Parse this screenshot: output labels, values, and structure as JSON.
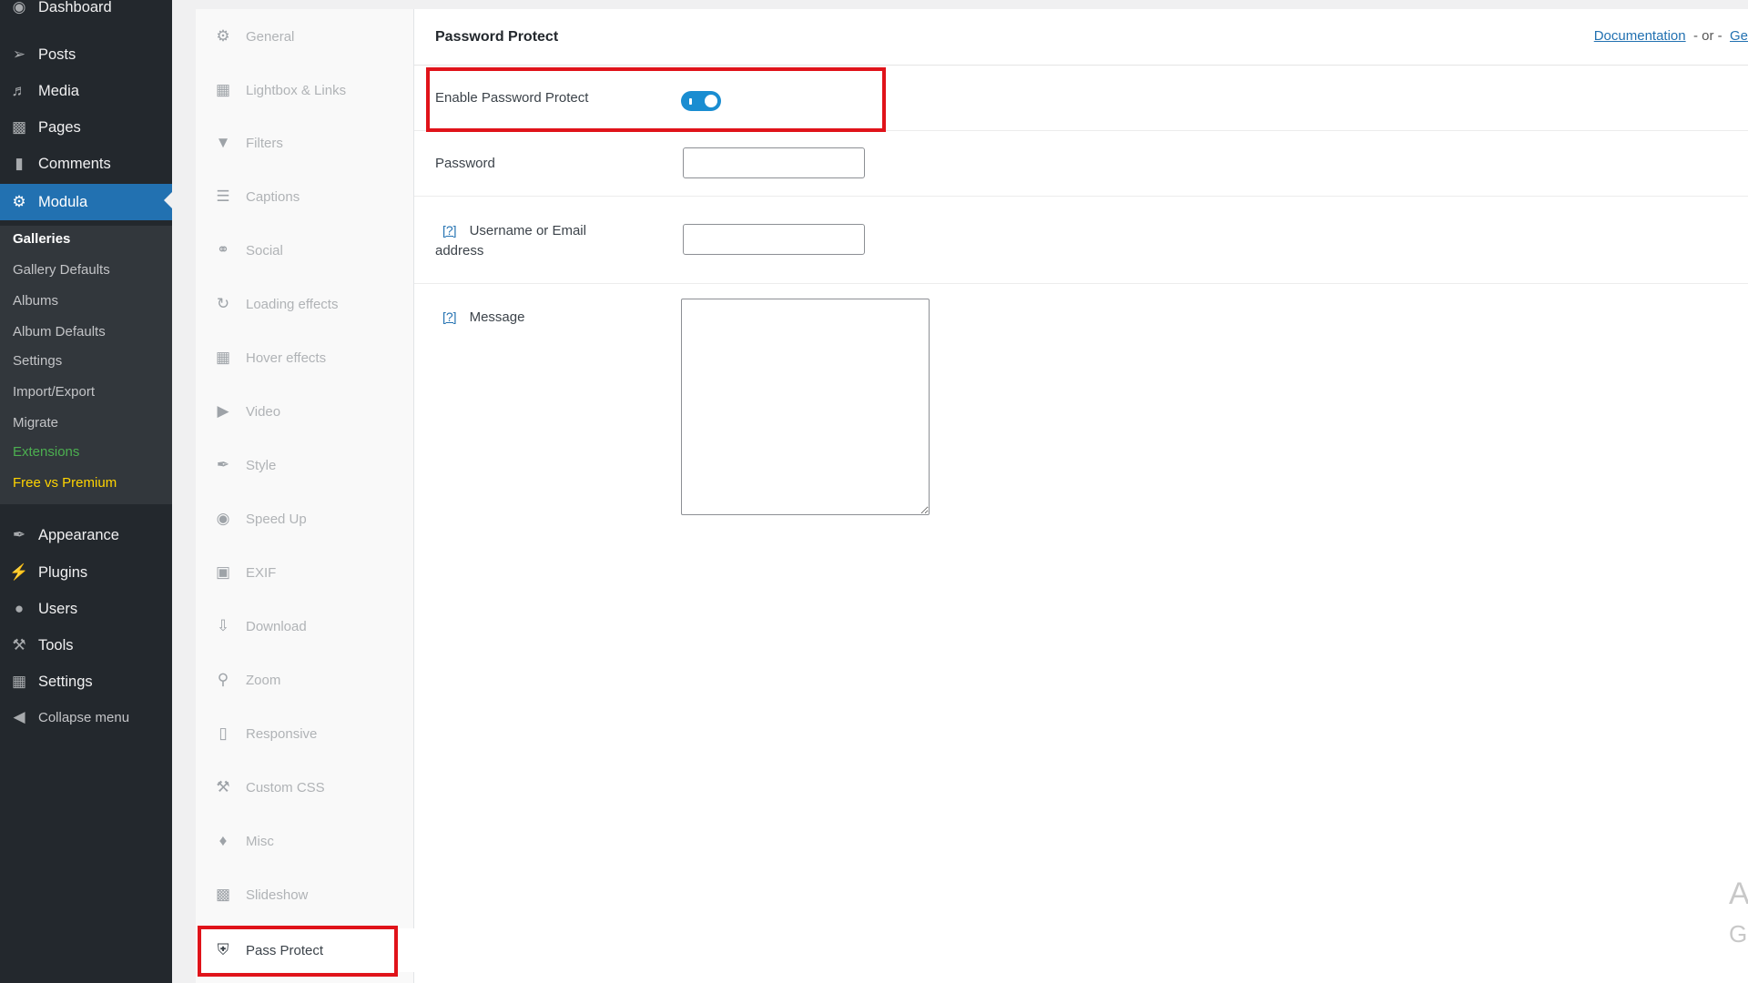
{
  "admin_menu": {
    "dashboard": "Dashboard",
    "posts": "Posts",
    "media": "Media",
    "pages": "Pages",
    "comments": "Comments",
    "modula": "Modula",
    "appearance": "Appearance",
    "plugins": "Plugins",
    "users": "Users",
    "tools": "Tools",
    "settings": "Settings",
    "collapse": "Collapse menu",
    "submenu": {
      "galleries": "Galleries",
      "gallery_defaults": "Gallery Defaults",
      "albums": "Albums",
      "album_defaults": "Album Defaults",
      "settings": "Settings",
      "import_export": "Import/Export",
      "migrate": "Migrate",
      "extensions": "Extensions",
      "free_vs_premium": "Free vs Premium"
    }
  },
  "tabs": {
    "general": "General",
    "lightbox": "Lightbox & Links",
    "filters": "Filters",
    "captions": "Captions",
    "social": "Social",
    "loading_effects": "Loading effects",
    "hover_effects": "Hover effects",
    "video": "Video",
    "style": "Style",
    "speed_up": "Speed Up",
    "exif": "EXIF",
    "download": "Download",
    "zoom": "Zoom",
    "responsive": "Responsive",
    "custom_css": "Custom CSS",
    "misc": "Misc",
    "slideshow": "Slideshow",
    "pass_protect": "Pass Protect"
  },
  "panel": {
    "title": "Password Protect",
    "documentation_link": "Documentation",
    "separator": "- or -",
    "second_link_partial": "Ge",
    "fields": {
      "enable_label": "Enable Password Protect",
      "enable_value": true,
      "password_label": "Password",
      "password_value": "",
      "help_marker": "[?]",
      "username_label_line1": "Username or Email",
      "username_label_line2": "address",
      "username_value": "",
      "message_label": "Message",
      "message_value": ""
    }
  },
  "colors": {
    "admin_bg": "#23282d",
    "submenu_bg": "#32373c",
    "accent": "#2271b1",
    "toggle_on": "#1a8dd1",
    "highlight_outline": "#e0131a",
    "extensions": "#4caf50",
    "premium": "#ffd400"
  },
  "watermark": {
    "line1": "A",
    "line2": "G"
  }
}
